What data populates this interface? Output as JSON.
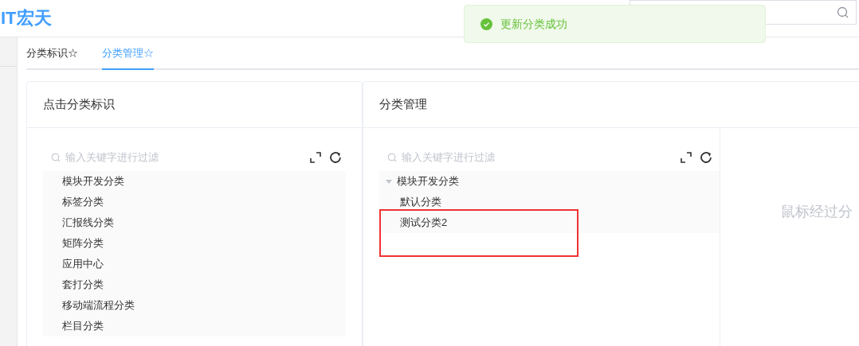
{
  "logo": "IT宏天",
  "toast": {
    "kind": "success",
    "message": "更新分类成功"
  },
  "tabs": [
    {
      "label": "分类标识☆",
      "selected": false
    },
    {
      "label": "分类管理☆",
      "selected": true
    }
  ],
  "left_panel": {
    "title": "点击分类标识",
    "filter": {
      "placeholder": "输入关键字进行过滤"
    },
    "items": [
      "模块开发分类",
      "标签分类",
      "汇报线分类",
      "矩阵分类",
      "应用中心",
      "套打分类",
      "移动端流程分类",
      "栏目分类"
    ]
  },
  "right_panel": {
    "title": "分类管理",
    "filter": {
      "placeholder": "输入关键字进行过滤"
    },
    "tree": [
      {
        "label": "模块开发分类",
        "expanded": true,
        "highlighted": false,
        "children": [
          {
            "label": "默认分类",
            "highlighted": false
          },
          {
            "label": "测试分类2",
            "highlighted": true
          }
        ]
      }
    ],
    "hint": "鼠标经过分"
  }
}
